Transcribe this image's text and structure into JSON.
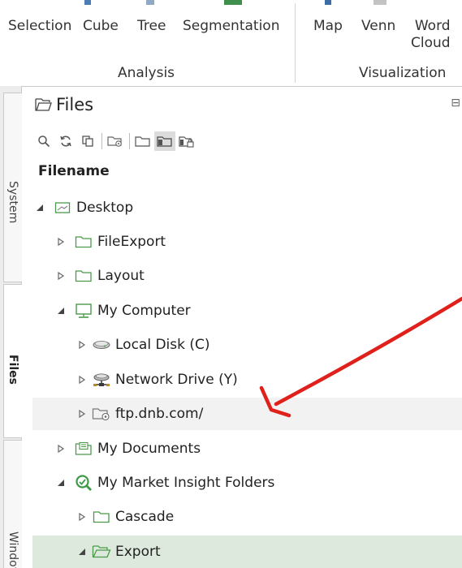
{
  "ribbon": {
    "analysis_group": {
      "label": "Analysis",
      "buttons": [
        "Selection",
        "Cube",
        "Tree",
        "Segmentation"
      ]
    },
    "visualization_group": {
      "label": "Visualization",
      "buttons": [
        "Map",
        "Venn"
      ],
      "word_cloud": {
        "line1": "Word",
        "line2": "Cloud"
      }
    }
  },
  "side_tabs": [
    "System",
    "Files",
    "Windows"
  ],
  "files_panel": {
    "title": "Files",
    "column_header": "Filename",
    "toolbar": [
      "search-icon",
      "refresh-icon",
      "copy-icon",
      "folder-ftp-icon",
      "folder-icon",
      "folder-filled-icon",
      "folder-locked-icon"
    ],
    "tree": [
      {
        "label": "Desktop",
        "expanded": true,
        "icon": "desktop-icon"
      },
      {
        "label": "FileExport",
        "expanded": false,
        "icon": "folder-icon"
      },
      {
        "label": "Layout",
        "expanded": false,
        "icon": "folder-icon"
      },
      {
        "label": "My Computer",
        "expanded": true,
        "icon": "computer-icon"
      },
      {
        "label": "Local Disk (C)",
        "expanded": false,
        "icon": "disk-icon"
      },
      {
        "label": "Network Drive (Y)",
        "expanded": false,
        "icon": "network-drive-icon"
      },
      {
        "label": "ftp.dnb.com/",
        "expanded": false,
        "icon": "ftp-folder-icon"
      },
      {
        "label": "My Documents",
        "expanded": false,
        "icon": "documents-icon"
      },
      {
        "label": "My Market Insight Folders",
        "expanded": true,
        "icon": "market-insight-icon"
      },
      {
        "label": "Cascade",
        "expanded": false,
        "icon": "folder-icon"
      },
      {
        "label": "Export",
        "expanded": true,
        "icon": "folder-open-icon"
      }
    ]
  },
  "colors": {
    "folder_green": "#4a9a4a",
    "selected_row": "#dde9dc",
    "hover_row": "#f2f2f2",
    "annotation_red": "#e0201b"
  }
}
